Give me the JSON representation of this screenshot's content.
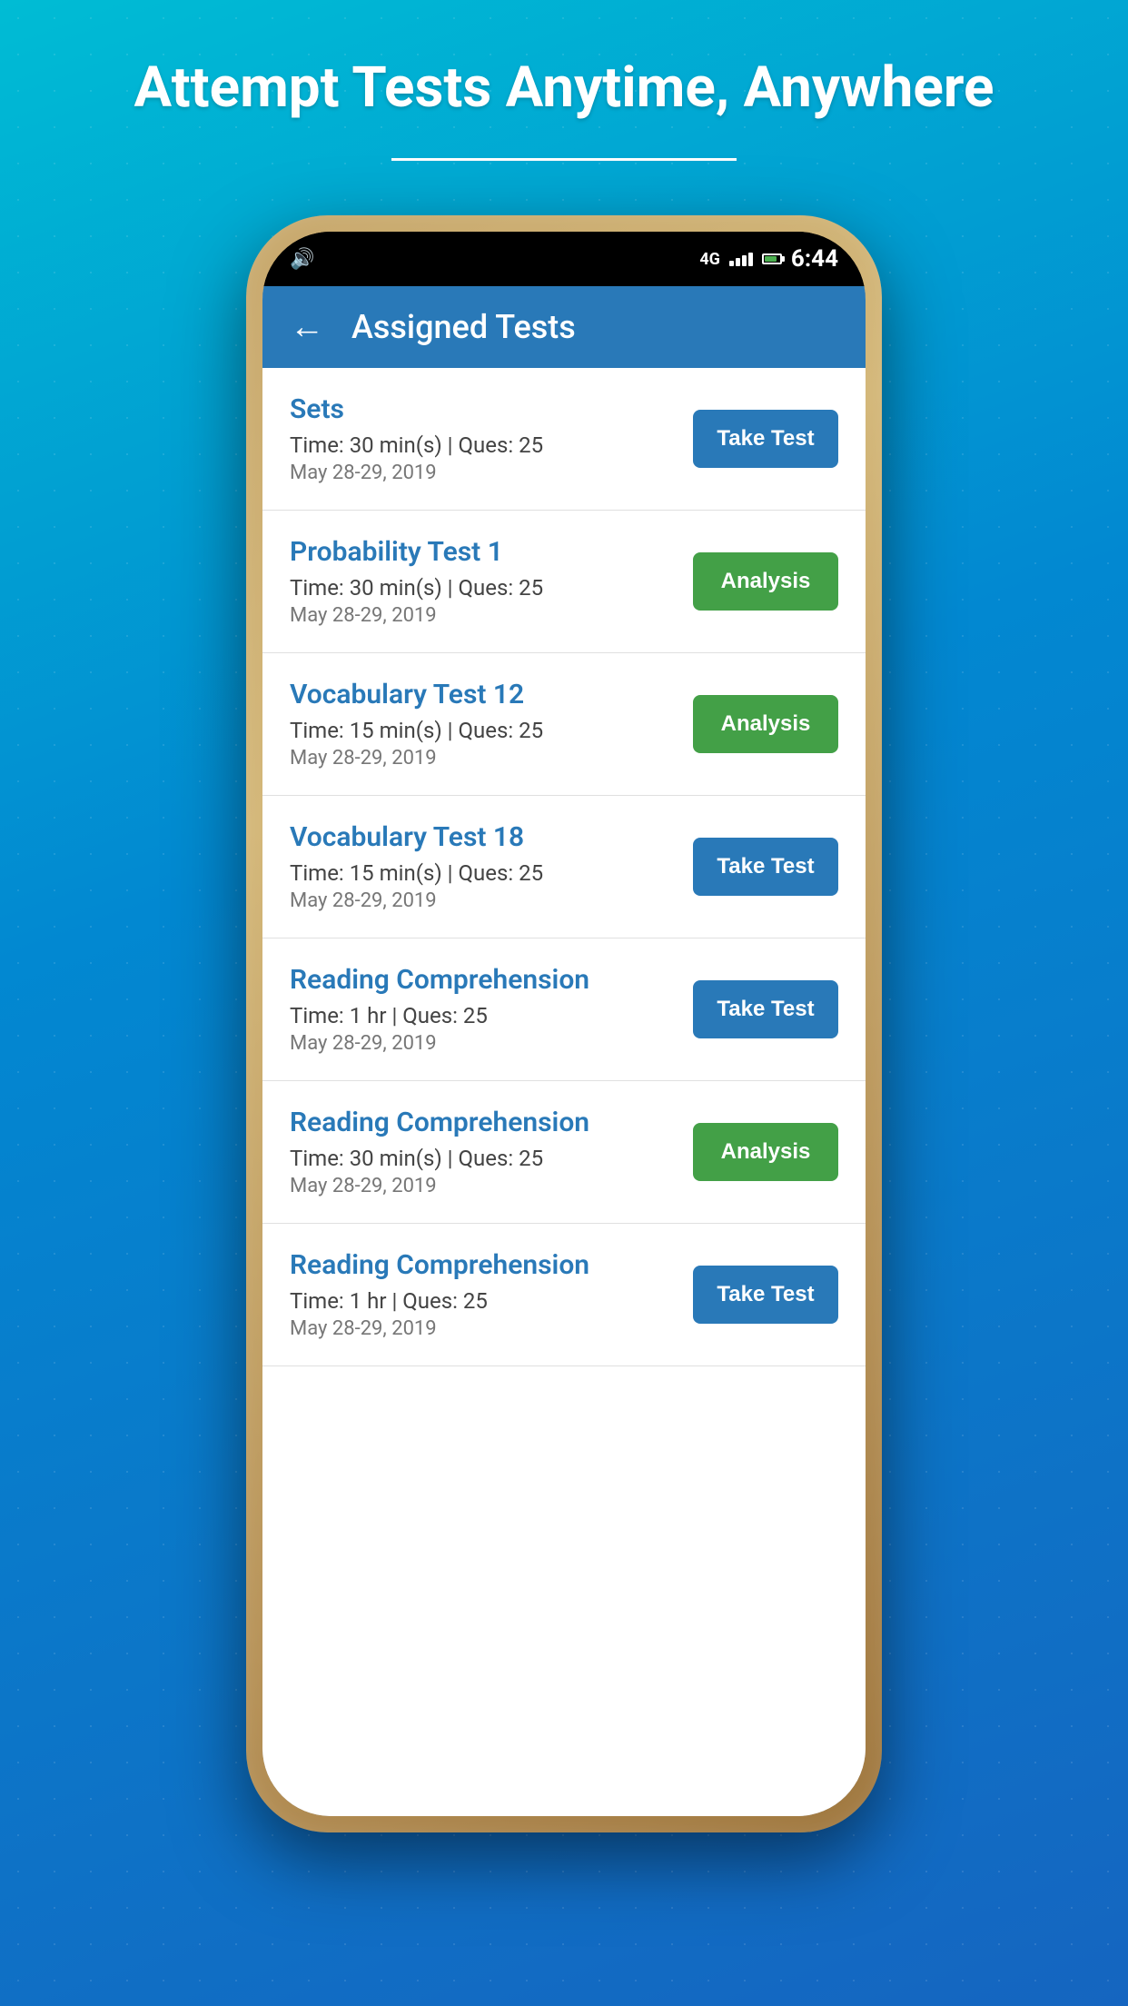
{
  "page": {
    "header_title": "Attempt Tests Anytime, Anywhere",
    "background_gradient_start": "#00bcd4",
    "background_gradient_end": "#1565c0"
  },
  "status_bar": {
    "time": "6:44",
    "network": "4G"
  },
  "nav_bar": {
    "title": "Assigned Tests",
    "back_label": "←"
  },
  "tests": [
    {
      "id": 1,
      "name": "Sets",
      "time": "Time: 30 min(s) | Ques: 25",
      "date": "May 28-29, 2019",
      "button_type": "take_test",
      "button_label": "Take Test"
    },
    {
      "id": 2,
      "name": "Probability Test 1",
      "time": "Time: 30 min(s) | Ques: 25",
      "date": "May 28-29, 2019",
      "button_type": "analysis",
      "button_label": "Analysis"
    },
    {
      "id": 3,
      "name": "Vocabulary Test 12",
      "time": "Time: 15 min(s) | Ques: 25",
      "date": "May 28-29, 2019",
      "button_type": "analysis",
      "button_label": "Analysis"
    },
    {
      "id": 4,
      "name": "Vocabulary Test 18",
      "time": "Time: 15 min(s) | Ques: 25",
      "date": "May 28-29, 2019",
      "button_type": "take_test",
      "button_label": "Take Test"
    },
    {
      "id": 5,
      "name": "Reading Comprehension",
      "time": "Time: 1 hr | Ques: 25",
      "date": "May 28-29, 2019",
      "button_type": "take_test",
      "button_label": "Take Test"
    },
    {
      "id": 6,
      "name": "Reading Comprehension",
      "time": "Time: 30 min(s) | Ques: 25",
      "date": "May 28-29, 2019",
      "button_type": "analysis",
      "button_label": "Analysis"
    },
    {
      "id": 7,
      "name": "Reading Comprehension",
      "time": "Time: 1 hr | Ques: 25",
      "date": "May 28-29, 2019",
      "button_type": "take_test",
      "button_label": "Take Test"
    }
  ],
  "colors": {
    "take_test_bg": "#2979b8",
    "analysis_bg": "#43a047",
    "nav_bar_bg": "#2979b8",
    "test_name_color": "#2979b8"
  }
}
